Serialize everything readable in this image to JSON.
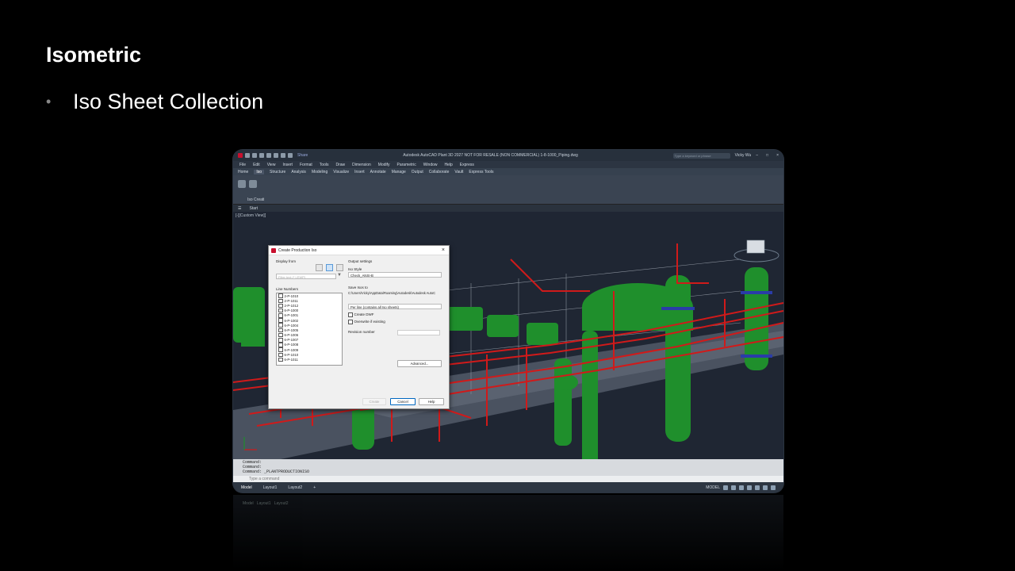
{
  "slide": {
    "title": "Isometric",
    "bullet": "Iso Sheet Collection"
  },
  "app": {
    "window_title": "Autodesk AutoCAD Plant 3D 2027 NOT FOR RESALE (NON COMMERCIAL)   1-8-1000_Piping.dwg",
    "share_label": "Share",
    "search_placeholder": "Type a keyword or phrase",
    "user": "Vicky Wu",
    "menus": [
      "File",
      "Edit",
      "View",
      "Insert",
      "Format",
      "Tools",
      "Draw",
      "Dimension",
      "Modify",
      "Parametric",
      "Window",
      "Help",
      "Express"
    ],
    "ribbon_tabs": [
      "Home",
      "Iso",
      "Structure",
      "Analysis",
      "Modeling",
      "Visualize",
      "Insert",
      "Annotate",
      "Manage",
      "Output",
      "Collaborate",
      "Vault",
      "Express Tools"
    ],
    "active_ribbon_tab": "Iso",
    "ribbon_panel_label": "Iso Creati",
    "file_tab": "Start",
    "view_label": "[-][Custom View][",
    "command_history": [
      "Command:",
      "Command:",
      "Command:  _PLANTPRODUCTIONISO"
    ],
    "command_placeholder": "Type a command",
    "layout_tabs": [
      "Model",
      "Layout1",
      "Layout2"
    ],
    "status_model": "MODEL"
  },
  "dialog": {
    "title": "Create Production Iso",
    "display_from_label": "Display from",
    "filter_placeholder": "Filter text (* LEWP)",
    "line_numbers_label": "Line Numbers",
    "line_numbers": [
      "2-P-1010",
      "2-P-1011",
      "2-P-1012",
      "6-P-1000",
      "6-P-1001",
      "6-P-1002",
      "6-P-1004",
      "6-P-1005",
      "6-P-1006",
      "6-P-1007",
      "6-P-1008",
      "6-P-1009",
      "6-P-1010",
      "6-P-1011"
    ],
    "output_settings_label": "Output settings",
    "iso_style_label": "Iso Style",
    "iso_style_value": "Check_ANSI-B",
    "save_to_label": "Save Isos to",
    "save_to_path": "C:\\Users\\Vicky\\AppData\\Roaming\\Autodesk\\Autodesk AutoC",
    "per_line_value": "Per line (contains all Iso sheets)",
    "create_dwf_label": "Create DWF",
    "overwrite_label": "Overwrite if existing",
    "revision_label": "Revision number",
    "advanced_button": "Advanced...",
    "create_button": "Create",
    "cancel_button": "Cancel",
    "help_button": "Help"
  },
  "colors": {
    "equipment": "#1f8f2c",
    "piping": "#d01a1a",
    "viewport_bg": "#1f2633"
  }
}
